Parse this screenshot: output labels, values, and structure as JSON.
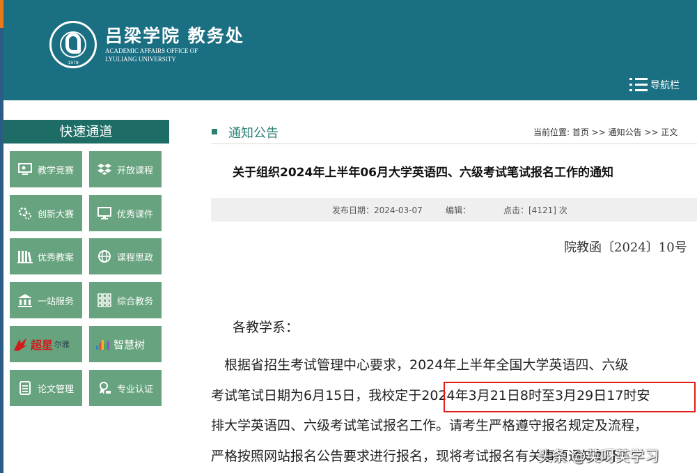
{
  "header": {
    "school_name": "吕梁学院 教务处",
    "english_line1": "ACADEMIC AFFAIRS OFFICE OF",
    "english_line2": "LYULIANG  UNIVERSITY",
    "logo_year": "·1978·",
    "nav_label": "导航栏",
    "bg_color": "#1b6f82"
  },
  "sidebar": {
    "title": "快速通道",
    "items": [
      {
        "label": "教学竞赛",
        "icon": "monitor-person-icon"
      },
      {
        "label": "开放课程",
        "icon": "dropbox-icon"
      },
      {
        "label": "创新大赛",
        "icon": "gears-icon"
      },
      {
        "label": "优秀课件",
        "icon": "desktop-icon"
      },
      {
        "label": "优秀教案",
        "icon": "books-icon"
      },
      {
        "label": "课程思政",
        "icon": "globe-icon"
      },
      {
        "label": "一站服务",
        "icon": "building-icon"
      },
      {
        "label": "综合教务",
        "icon": "grid-icon"
      },
      {
        "label": "尔雅",
        "brand": "超星",
        "icon": "chaoxing-logo-icon"
      },
      {
        "label": "智慧树",
        "icon": "zhihuishu-logo-icon"
      },
      {
        "label": "论文管理",
        "icon": "document-icon"
      },
      {
        "label": "专业认证",
        "icon": "certificate-icon"
      }
    ],
    "item_color": "#67a37e"
  },
  "content": {
    "section_title": "通知公告",
    "breadcrumb": "当前位置: 首页 >> 通知公告 >> 正文",
    "article_title": "关于组织2024年上半年06月大学英语四、六级考试笔试报名工作的通知",
    "meta": {
      "publish_date": "发布日期：2024-03-07",
      "editor": "编辑：",
      "clicks": "点击：[4121] 次"
    },
    "doc_number": "院教函〔2024〕10号",
    "salutation": "各教学系：",
    "paragraph_lines": [
      "　根据省招生考试管理中心要求，2024年上半年全国大学英语四、六级",
      "考试笔试日期为6月15日，我校定于2024年3月21日8时至3月29日17时安",
      "排大学英语四、六级考试笔试报名工作。请考生严格遵守报名规定及流程，",
      "严格按照网站报名公告要求进行报名，现将考试报名有关事项通知如下："
    ]
  },
  "watermark": "头条 @英呀英学习"
}
